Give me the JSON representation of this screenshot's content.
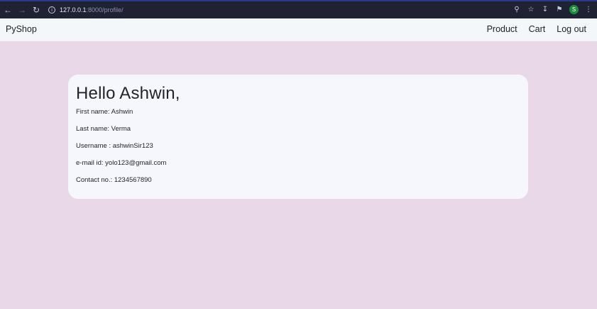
{
  "browser": {
    "url_host": "127.0.0.1",
    "url_path": ":8000/profile/",
    "profile_initial": "S"
  },
  "navbar": {
    "brand": "PyShop",
    "links": [
      "Product",
      "Cart",
      "Log out"
    ]
  },
  "profile": {
    "greeting": "Hello Ashwin,",
    "first_name": "First name: Ashwin",
    "last_name": "Last name: Verma",
    "username": "Username : ashwinSir123",
    "email": "e-mail id: yolo123@gmail.com",
    "contact": "Contact no.: 1234567890"
  },
  "colors": {
    "page_bg": "#e8d8e8",
    "navbar_bg": "#f3f7f9",
    "card_bg": "#f6f7fc",
    "chrome_bg": "#1f2233"
  }
}
